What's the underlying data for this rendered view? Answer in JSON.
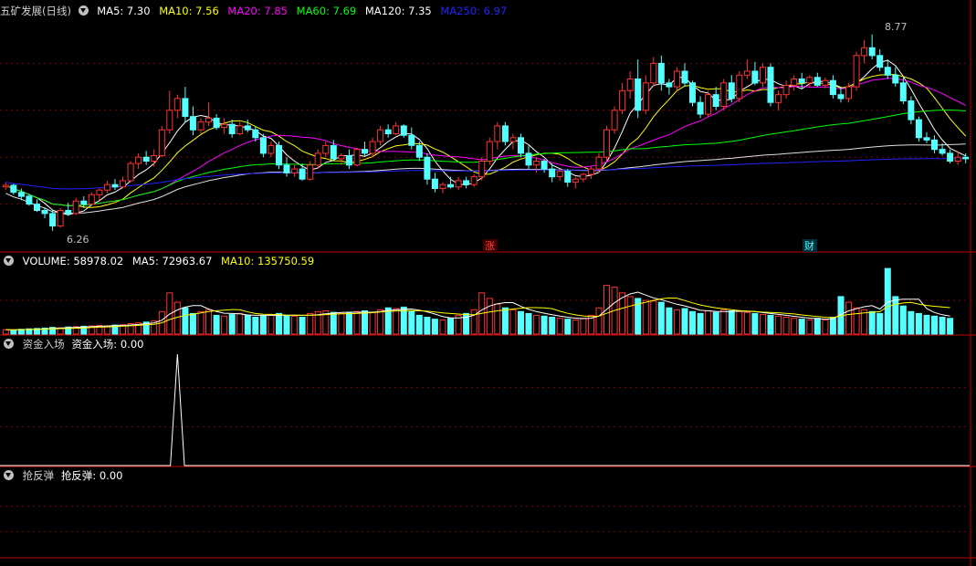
{
  "title": "五矿发展(日线)",
  "ma_legend": [
    {
      "label": "MA5: 7.30",
      "color": "#ffffff"
    },
    {
      "label": "MA10: 7.56",
      "color": "#ffff00"
    },
    {
      "label": "MA20: 7.85",
      "color": "#ff00ff"
    },
    {
      "label": "MA60: 7.69",
      "color": "#00ff00"
    },
    {
      "label": "MA120: 7.35",
      "color": "#ffffff"
    },
    {
      "label": "MA250: 6.97",
      "color": "#2222ff"
    }
  ],
  "vol_legend": [
    {
      "label": "VOLUME: 58978.02",
      "color": "#ffffff"
    },
    {
      "label": "MA5: 72963.67",
      "color": "#ffffff"
    },
    {
      "label": "MA10: 135750.59",
      "color": "#ffff00"
    }
  ],
  "ind1": {
    "name": "资金入场",
    "value": "资金入场: 0.00"
  },
  "ind2": {
    "name": "抢反弹",
    "value": "抢反弹: 0.00"
  },
  "marks": {
    "high": "8.77",
    "low": "6.26",
    "zhang": "涨",
    "cai": "财"
  },
  "colors": {
    "up": "#ff3232",
    "down": "#54ffff",
    "grid": "#7a0000",
    "frame": "#c00000"
  },
  "chart_data": {
    "type": "candlestick",
    "title": "五矿发展(日线)",
    "ylim": [
      6.0,
      9.0
    ],
    "candles": [
      [
        6.82,
        6.88,
        6.78,
        6.84
      ],
      [
        6.84,
        6.86,
        6.72,
        6.75
      ],
      [
        6.75,
        6.8,
        6.65,
        6.7
      ],
      [
        6.7,
        6.73,
        6.58,
        6.6
      ],
      [
        6.6,
        6.66,
        6.5,
        6.52
      ],
      [
        6.52,
        6.56,
        6.42,
        6.48
      ],
      [
        6.48,
        6.52,
        6.26,
        6.32
      ],
      [
        6.32,
        6.55,
        6.3,
        6.52
      ],
      [
        6.52,
        6.62,
        6.45,
        6.48
      ],
      [
        6.48,
        6.68,
        6.46,
        6.64
      ],
      [
        6.64,
        6.7,
        6.55,
        6.6
      ],
      [
        6.6,
        6.75,
        6.58,
        6.72
      ],
      [
        6.72,
        6.8,
        6.65,
        6.78
      ],
      [
        6.78,
        6.9,
        6.74,
        6.85
      ],
      [
        6.85,
        6.92,
        6.78,
        6.82
      ],
      [
        6.82,
        6.95,
        6.8,
        6.9
      ],
      [
        6.9,
        7.15,
        6.88,
        7.12
      ],
      [
        7.12,
        7.25,
        7.05,
        7.2
      ],
      [
        7.2,
        7.28,
        7.1,
        7.15
      ],
      [
        7.15,
        7.3,
        7.08,
        7.22
      ],
      [
        7.22,
        7.6,
        7.2,
        7.55
      ],
      [
        7.55,
        8.05,
        7.5,
        7.8
      ],
      [
        7.8,
        8.0,
        7.7,
        7.95
      ],
      [
        7.95,
        8.1,
        7.65,
        7.72
      ],
      [
        7.72,
        7.85,
        7.48,
        7.55
      ],
      [
        7.55,
        7.7,
        7.5,
        7.65
      ],
      [
        7.65,
        7.9,
        7.6,
        7.7
      ],
      [
        7.7,
        7.75,
        7.55,
        7.58
      ],
      [
        7.58,
        7.7,
        7.5,
        7.62
      ],
      [
        7.62,
        7.68,
        7.45,
        7.5
      ],
      [
        7.5,
        7.65,
        7.48,
        7.6
      ],
      [
        7.6,
        7.68,
        7.52,
        7.55
      ],
      [
        7.55,
        7.6,
        7.4,
        7.45
      ],
      [
        7.45,
        7.5,
        7.2,
        7.25
      ],
      [
        7.25,
        7.4,
        7.2,
        7.35
      ],
      [
        7.35,
        7.4,
        7.05,
        7.1
      ],
      [
        7.1,
        7.2,
        6.95,
        7.0
      ],
      [
        7.0,
        7.1,
        6.95,
        7.05
      ],
      [
        7.05,
        7.12,
        6.9,
        6.92
      ],
      [
        6.92,
        7.15,
        6.9,
        7.1
      ],
      [
        7.1,
        7.3,
        7.05,
        7.25
      ],
      [
        7.25,
        7.4,
        7.2,
        7.35
      ],
      [
        7.35,
        7.42,
        7.15,
        7.18
      ],
      [
        7.18,
        7.25,
        7.1,
        7.22
      ],
      [
        7.22,
        7.3,
        7.05,
        7.1
      ],
      [
        7.1,
        7.32,
        7.08,
        7.3
      ],
      [
        7.3,
        7.4,
        7.22,
        7.25
      ],
      [
        7.25,
        7.45,
        7.2,
        7.4
      ],
      [
        7.4,
        7.6,
        7.35,
        7.55
      ],
      [
        7.55,
        7.62,
        7.45,
        7.5
      ],
      [
        7.5,
        7.65,
        7.48,
        7.6
      ],
      [
        7.6,
        7.62,
        7.45,
        7.48
      ],
      [
        7.48,
        7.58,
        7.3,
        7.35
      ],
      [
        7.35,
        7.4,
        7.15,
        7.2
      ],
      [
        7.2,
        7.25,
        6.85,
        6.92
      ],
      [
        6.92,
        7.0,
        6.75,
        6.8
      ],
      [
        6.8,
        6.88,
        6.74,
        6.85
      ],
      [
        6.85,
        6.95,
        6.8,
        6.82
      ],
      [
        6.82,
        6.95,
        6.78,
        6.9
      ],
      [
        6.9,
        6.95,
        6.8,
        6.85
      ],
      [
        6.85,
        6.98,
        6.82,
        6.95
      ],
      [
        6.95,
        7.2,
        6.9,
        7.15
      ],
      [
        7.15,
        7.45,
        7.1,
        7.4
      ],
      [
        7.4,
        7.65,
        7.3,
        7.6
      ],
      [
        7.6,
        7.65,
        7.35,
        7.4
      ],
      [
        7.4,
        7.5,
        7.3,
        7.45
      ],
      [
        7.45,
        7.5,
        7.2,
        7.25
      ],
      [
        7.25,
        7.35,
        7.05,
        7.1
      ],
      [
        7.1,
        7.2,
        7.0,
        7.15
      ],
      [
        7.15,
        7.18,
        7.0,
        7.05
      ],
      [
        7.05,
        7.12,
        6.88,
        6.95
      ],
      [
        6.95,
        7.05,
        6.9,
        7.02
      ],
      [
        7.02,
        7.05,
        6.82,
        6.88
      ],
      [
        6.88,
        6.95,
        6.8,
        6.92
      ],
      [
        6.92,
        7.0,
        6.88,
        6.98
      ],
      [
        6.98,
        7.08,
        6.92,
        7.05
      ],
      [
        7.05,
        7.25,
        7.0,
        7.2
      ],
      [
        7.2,
        7.6,
        7.15,
        7.55
      ],
      [
        7.55,
        7.85,
        7.5,
        7.8
      ],
      [
        7.8,
        8.15,
        7.75,
        8.05
      ],
      [
        8.05,
        8.3,
        7.95,
        8.2
      ],
      [
        8.2,
        8.45,
        7.7,
        7.8
      ],
      [
        7.8,
        8.25,
        7.75,
        8.15
      ],
      [
        8.15,
        8.48,
        8.1,
        8.4
      ],
      [
        8.4,
        8.5,
        8.05,
        8.15
      ],
      [
        8.15,
        8.2,
        8.0,
        8.1
      ],
      [
        8.1,
        8.35,
        8.05,
        8.3
      ],
      [
        8.3,
        8.4,
        8.1,
        8.15
      ],
      [
        8.15,
        8.18,
        7.85,
        7.9
      ],
      [
        7.9,
        7.98,
        7.7,
        7.75
      ],
      [
        7.75,
        8.05,
        7.72,
        8.0
      ],
      [
        8.0,
        8.1,
        7.8,
        7.85
      ],
      [
        7.85,
        8.2,
        7.8,
        8.15
      ],
      [
        8.15,
        8.25,
        7.9,
        7.95
      ],
      [
        7.95,
        8.3,
        7.9,
        8.25
      ],
      [
        8.25,
        8.45,
        8.2,
        8.3
      ],
      [
        8.3,
        8.42,
        8.12,
        8.15
      ],
      [
        8.15,
        8.4,
        8.1,
        8.35
      ],
      [
        8.35,
        8.4,
        7.85,
        7.9
      ],
      [
        7.9,
        8.05,
        7.8,
        8.0
      ],
      [
        8.0,
        8.18,
        7.95,
        8.12
      ],
      [
        8.12,
        8.25,
        8.05,
        8.2
      ],
      [
        8.2,
        8.28,
        8.08,
        8.15
      ],
      [
        8.15,
        8.25,
        8.1,
        8.22
      ],
      [
        8.22,
        8.28,
        8.1,
        8.12
      ],
      [
        8.12,
        8.22,
        8.08,
        8.18
      ],
      [
        8.18,
        8.25,
        7.95,
        8.0
      ],
      [
        8.0,
        8.1,
        7.9,
        7.95
      ],
      [
        7.95,
        8.15,
        7.9,
        8.1
      ],
      [
        8.1,
        8.55,
        8.05,
        8.5
      ],
      [
        8.5,
        8.7,
        8.4,
        8.6
      ],
      [
        8.6,
        8.77,
        8.45,
        8.5
      ],
      [
        8.5,
        8.58,
        8.3,
        8.35
      ],
      [
        8.35,
        8.45,
        8.2,
        8.25
      ],
      [
        8.25,
        8.35,
        8.1,
        8.15
      ],
      [
        8.15,
        8.22,
        7.88,
        7.92
      ],
      [
        7.92,
        7.98,
        7.62,
        7.68
      ],
      [
        7.68,
        7.72,
        7.4,
        7.45
      ],
      [
        7.45,
        7.52,
        7.38,
        7.42
      ],
      [
        7.42,
        7.48,
        7.25,
        7.3
      ],
      [
        7.3,
        7.38,
        7.22,
        7.25
      ],
      [
        7.25,
        7.3,
        7.12,
        7.15
      ],
      [
        7.15,
        7.28,
        7.1,
        7.2
      ],
      [
        7.2,
        7.25,
        7.12,
        7.18
      ]
    ],
    "volumes": [
      12000,
      11000,
      13000,
      14000,
      15000,
      16000,
      18000,
      17000,
      19000,
      20000,
      21000,
      22000,
      23000,
      22000,
      24000,
      25000,
      28000,
      30000,
      32000,
      35000,
      60000,
      110000,
      85000,
      70000,
      55000,
      60000,
      65000,
      50000,
      48000,
      52000,
      55000,
      50000,
      45000,
      48000,
      52000,
      55000,
      50000,
      48000,
      45000,
      55000,
      60000,
      62000,
      58000,
      55000,
      57000,
      60000,
      62000,
      58000,
      65000,
      70000,
      68000,
      72000,
      60000,
      50000,
      45000,
      40000,
      38000,
      42000,
      50000,
      55000,
      65000,
      110000,
      95000,
      80000,
      70000,
      65000,
      60000,
      55000,
      50000,
      48000,
      45000,
      42000,
      40000,
      38000,
      42000,
      50000,
      70000,
      130000,
      125000,
      110000,
      100000,
      95000,
      90000,
      88000,
      85000,
      70000,
      65000,
      68000,
      60000,
      55000,
      62000,
      58000,
      65000,
      62000,
      60000,
      58000,
      55000,
      52000,
      50000,
      48000,
      45000,
      42000,
      40000,
      38000,
      42000,
      38000,
      45000,
      100000,
      85000,
      70000,
      65000,
      60000,
      55000,
      175000,
      100000,
      75000,
      60000,
      55000,
      50000,
      48000,
      45000,
      42000
    ],
    "ind1_spike_index": 22
  }
}
